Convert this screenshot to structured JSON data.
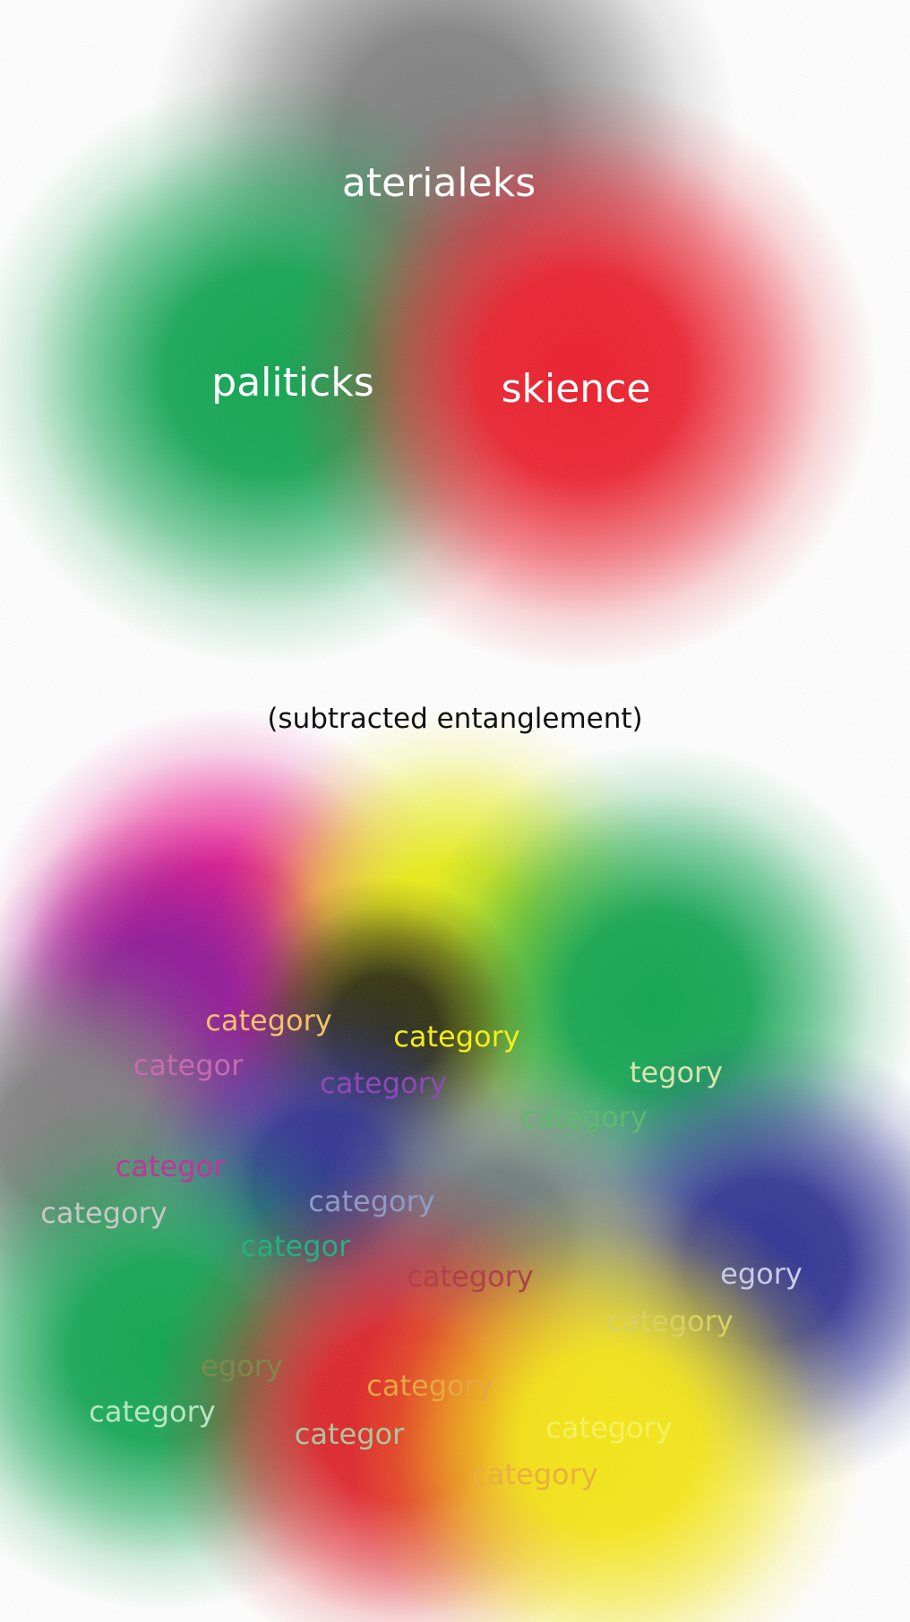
{
  "top_diagram": {
    "blobs": [
      {
        "id": "gray",
        "color": "#7f7f7f"
      },
      {
        "id": "green",
        "color": "#0fa450"
      },
      {
        "id": "red",
        "color": "#ec1c2a"
      }
    ],
    "labels": {
      "aterialeks": "aterialeks",
      "palitick": "paliticks",
      "skience": "skience"
    }
  },
  "caption": "(subtracted entanglement)",
  "bottom_diagram": {
    "blobs": [
      {
        "id": "magenta",
        "color": "#e9118a"
      },
      {
        "id": "yellow-top",
        "color": "#e8ec10"
      },
      {
        "id": "purple",
        "color": "#8e1a99"
      },
      {
        "id": "green-top-right",
        "color": "#0fa450"
      },
      {
        "id": "dark-olive",
        "color": "#2b2b12"
      },
      {
        "id": "gray",
        "color": "#7f7f7f"
      },
      {
        "id": "navy",
        "color": "#2e3192"
      },
      {
        "id": "blue-right",
        "color": "#2e3192"
      },
      {
        "id": "gray-center",
        "color": "#6f7a7a"
      },
      {
        "id": "green-bottom-left",
        "color": "#0fa450"
      },
      {
        "id": "red",
        "color": "#e01e26"
      },
      {
        "id": "yellow-bottom",
        "color": "#f5e613"
      }
    ],
    "labels": [
      {
        "text": "category",
        "color": "#f2c36a"
      },
      {
        "text": "category",
        "color": "#f2ee1a"
      },
      {
        "text": "categor",
        "color": "#c46bb0"
      },
      {
        "text": "category",
        "color": "#8e49b8"
      },
      {
        "text": "tegory",
        "color": "#d8e3b0"
      },
      {
        "text": "category",
        "color": "#5fb86f"
      },
      {
        "text": "categor",
        "color": "#c0359a"
      },
      {
        "text": "category",
        "color": "#c8c8c8"
      },
      {
        "text": "category",
        "color": "#8f9bc4"
      },
      {
        "text": "categor",
        "color": "#26b080"
      },
      {
        "text": "category",
        "color": "#b0404a"
      },
      {
        "text": "egory",
        "color": "#c8cbe8"
      },
      {
        "text": "category",
        "color": "#d8d160"
      },
      {
        "text": "egory",
        "color": "#7c8a4a"
      },
      {
        "text": "category",
        "color": "#e6a840"
      },
      {
        "text": "category",
        "color": "#b8e6c0"
      },
      {
        "text": "categor",
        "color": "#a8c8a0"
      },
      {
        "text": "category",
        "color": "#f5f060"
      },
      {
        "text": "category",
        "color": "#e8b040"
      }
    ]
  }
}
